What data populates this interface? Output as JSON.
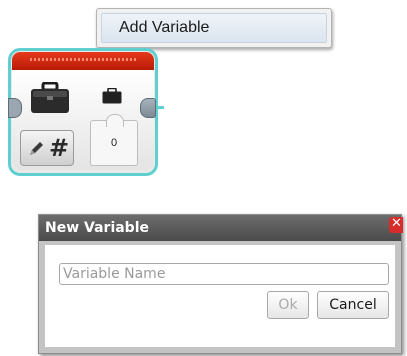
{
  "context_menu": {
    "items": [
      {
        "label": "Add Variable"
      }
    ]
  },
  "variable_block": {
    "value": "0",
    "mode_symbol": "#",
    "icons": [
      "briefcase-icon",
      "pencil-icon",
      "hash-icon"
    ],
    "colors": {
      "header": "#d1270f",
      "selection_glow": "#5fcfd0"
    }
  },
  "dialog": {
    "title": "New Variable",
    "close_symbol": "✕",
    "name_input": {
      "placeholder": "Variable Name",
      "value": ""
    },
    "ok_label": "Ok",
    "cancel_label": "Cancel"
  }
}
